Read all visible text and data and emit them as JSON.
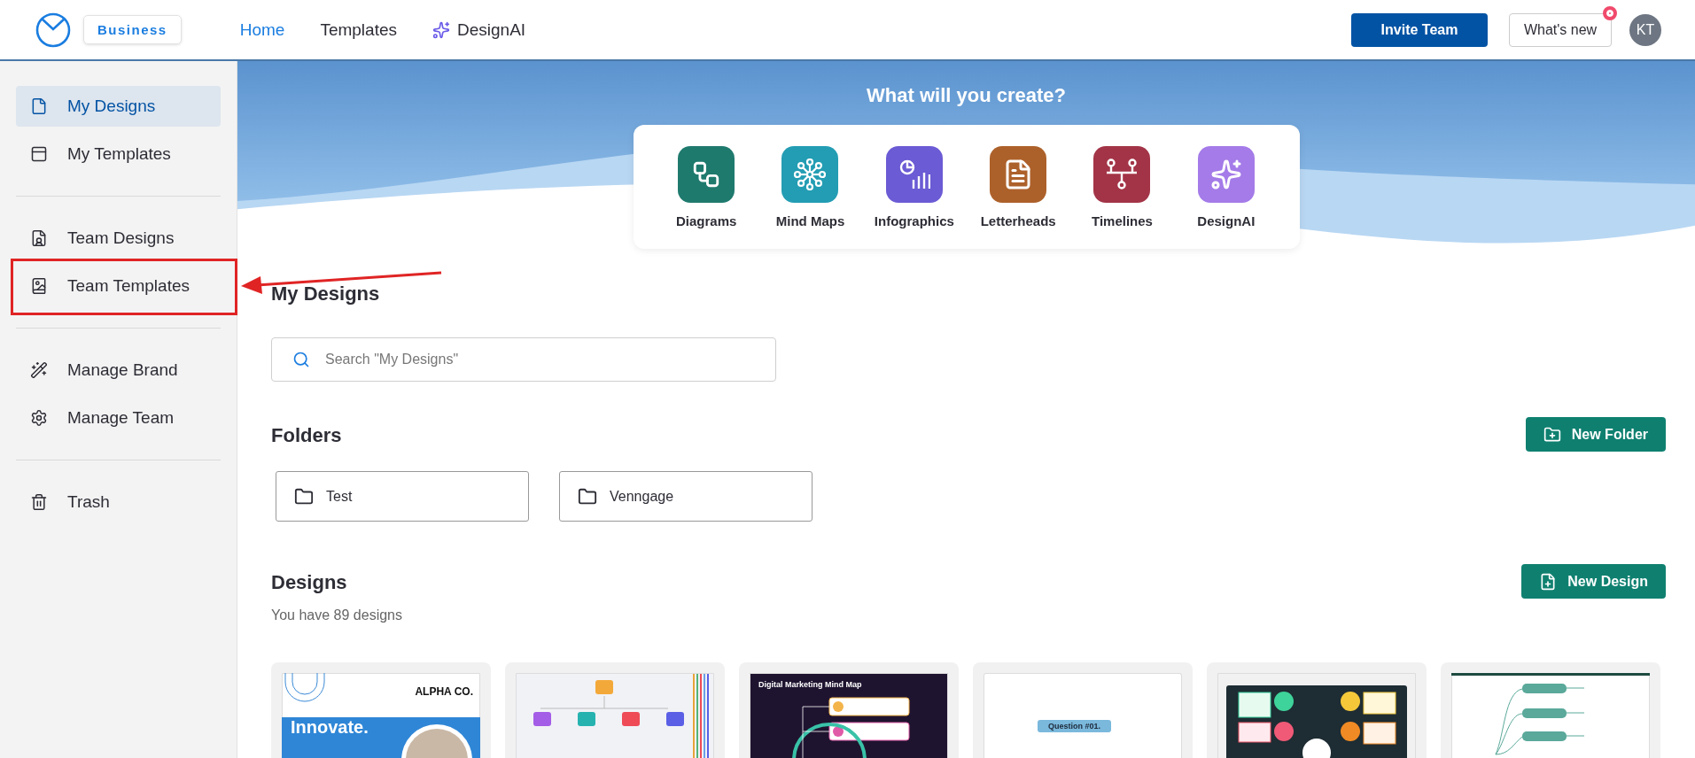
{
  "header": {
    "badge": "Business",
    "nav": [
      {
        "label": "Home",
        "selected": true
      },
      {
        "label": "Templates",
        "selected": false
      },
      {
        "label": "DesignAI",
        "selected": false
      }
    ],
    "invite_button": "Invite Team",
    "whats_new": {
      "label": "What's new",
      "notification": true
    },
    "avatar": "KT"
  },
  "sidebar": {
    "groups": [
      [
        {
          "label": "My Designs",
          "selected": true,
          "annotated": false
        },
        {
          "label": "My Templates",
          "selected": false,
          "annotated": false
        }
      ],
      [
        {
          "label": "Team Designs",
          "selected": false,
          "annotated": false
        },
        {
          "label": "Team Templates",
          "selected": false,
          "annotated": true
        }
      ],
      [
        {
          "label": "Manage Brand",
          "selected": false,
          "annotated": false
        },
        {
          "label": "Manage Team",
          "selected": false,
          "annotated": false
        }
      ],
      [
        {
          "label": "Trash",
          "selected": false,
          "annotated": false
        }
      ]
    ]
  },
  "hero": {
    "title": "What will you create?",
    "categories": [
      {
        "label": "Diagrams",
        "color": "#1f7a6e"
      },
      {
        "label": "Mind Maps",
        "color": "#239db3"
      },
      {
        "label": "Infographics",
        "color": "#6b5bd4"
      },
      {
        "label": "Letterheads",
        "color": "#ad612a"
      },
      {
        "label": "Timelines",
        "color": "#a33447"
      },
      {
        "label": "DesignAI",
        "color": "#a47be8"
      }
    ]
  },
  "my_designs": {
    "heading": "My Designs",
    "search_placeholder": "Search \"My Designs\""
  },
  "folders": {
    "heading": "Folders",
    "new_button": "New Folder",
    "items": [
      "Test",
      "Venngage"
    ]
  },
  "designs": {
    "heading": "Designs",
    "new_button": "New Design",
    "count": "You have 89 designs",
    "thumbnails": [
      {
        "kind": "poster",
        "brand": "ALPHA CO.",
        "headline": "Innovate."
      },
      {
        "kind": "sitemap"
      },
      {
        "kind": "mindmap",
        "title": "Digital Marketing Mind Map"
      },
      {
        "kind": "quiz",
        "question": "Question #01."
      },
      {
        "kind": "dark_chart"
      },
      {
        "kind": "strategy"
      }
    ]
  }
}
